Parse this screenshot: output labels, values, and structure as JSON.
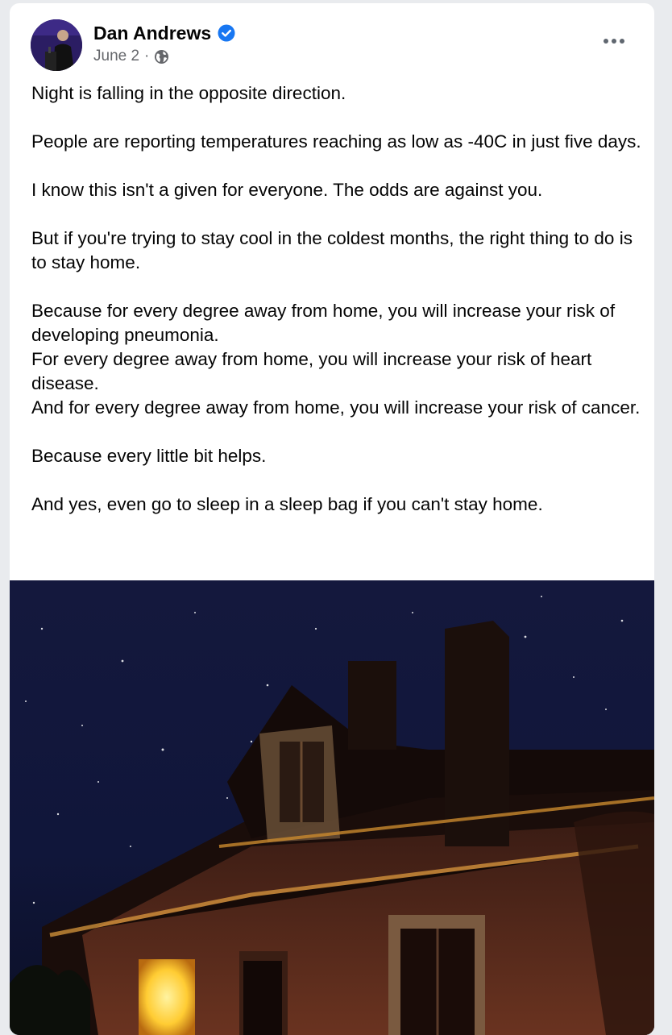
{
  "post": {
    "author": "Dan Andrews",
    "date": "June 2",
    "separator": "·",
    "paragraphs": [
      [
        "Night is falling in the opposite direction."
      ],
      [
        "People are reporting temperatures reaching as low as -40C in just five days."
      ],
      [
        "I know this isn't a given for everyone. The odds are against you."
      ],
      [
        "But if you're trying to stay cool in the coldest months, the right thing to do is to stay home."
      ],
      [
        "Because for every degree away from home, you will increase your risk of developing pneumonia.",
        "For every degree away from home, you will increase your risk of heart disease.",
        "And for every degree away from home, you will increase your risk of cancer."
      ],
      [
        "Because every little bit helps."
      ],
      [
        "And yes, even go to sleep in a sleep bag if you can't stay home."
      ]
    ]
  },
  "icons": {
    "verified": "verified-badge-icon",
    "privacy": "globe-icon",
    "more": "more-options-icon"
  },
  "colors": {
    "verified": "#1877f2",
    "meta_text": "#65676b",
    "body_text": "#050505",
    "window_light": "#ffd24a"
  }
}
